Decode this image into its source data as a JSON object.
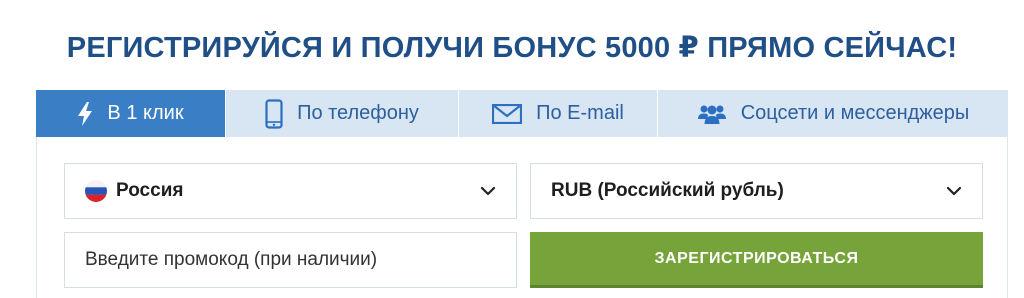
{
  "headline": "РЕГИСТРИРУЙСЯ И ПОЛУЧИ БОНУС 5000 ₽ ПРЯМО СЕЙЧАС!",
  "tabs": [
    {
      "label": "В 1 клик",
      "icon": "lightning-icon",
      "active": true
    },
    {
      "label": "По телефону",
      "icon": "phone-icon",
      "active": false
    },
    {
      "label": "По E-mail",
      "icon": "envelope-icon",
      "active": false
    },
    {
      "label": "Соцсети и мессенджеры",
      "icon": "users-icon",
      "active": false
    }
  ],
  "form": {
    "country": {
      "value": "Россия",
      "flag_icon": "russia-flag-icon"
    },
    "currency": {
      "value": "RUB (Российский рубль)"
    },
    "promo": {
      "placeholder": "Введите промокод (при наличии)"
    },
    "register_label": "ЗАРЕГИСТРИРОВАТЬСЯ"
  },
  "colors": {
    "headline": "#1f4f86",
    "tab_active_bg": "#3a7fc6",
    "tab_inactive_bg": "#d8e6f3",
    "tab_inactive_text": "#2c5f9e",
    "register_bg": "#77a33b"
  }
}
